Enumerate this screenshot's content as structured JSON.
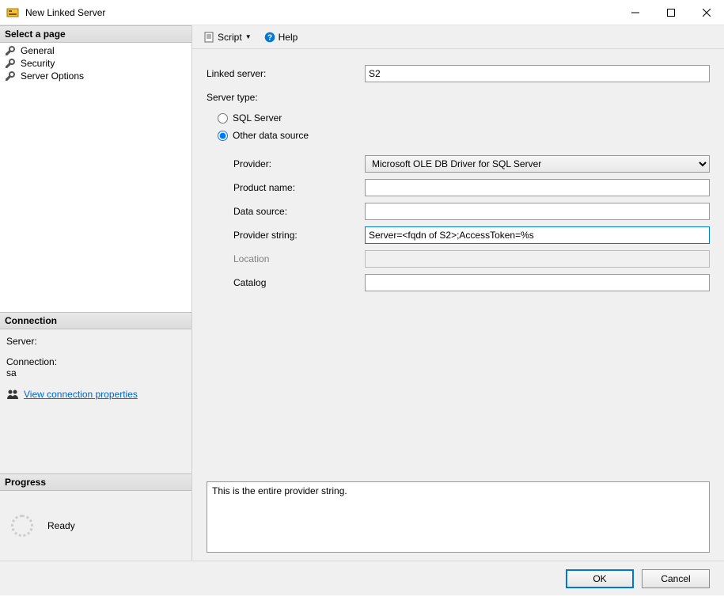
{
  "window": {
    "title": "New Linked Server"
  },
  "sidebar": {
    "select_page_header": "Select a page",
    "pages": [
      {
        "label": "General"
      },
      {
        "label": "Security"
      },
      {
        "label": "Server Options"
      }
    ],
    "connection_header": "Connection",
    "server_label": "Server:",
    "server_value": "",
    "connection_label": "Connection:",
    "connection_value": "sa",
    "view_conn_props": "View connection properties",
    "progress_header": "Progress",
    "progress_status": "Ready"
  },
  "toolbar": {
    "script_label": "Script",
    "help_label": "Help"
  },
  "form": {
    "linked_server_label": "Linked server:",
    "linked_server_value": "S2",
    "server_type_label": "Server type:",
    "radio_sql_server": "SQL Server",
    "radio_other": "Other data source",
    "provider_label": "Provider:",
    "provider_value": "Microsoft OLE DB Driver for SQL Server",
    "product_name_label": "Product name:",
    "product_name_value": "",
    "data_source_label": "Data source:",
    "data_source_value": "",
    "provider_string_label": "Provider string:",
    "provider_string_value": "Server=<fqdn of S2>;AccessToken=%s",
    "location_label": "Location",
    "location_value": "",
    "catalog_label": "Catalog",
    "catalog_value": "",
    "notes": "This is the entire provider string."
  },
  "buttons": {
    "ok": "OK",
    "cancel": "Cancel"
  }
}
